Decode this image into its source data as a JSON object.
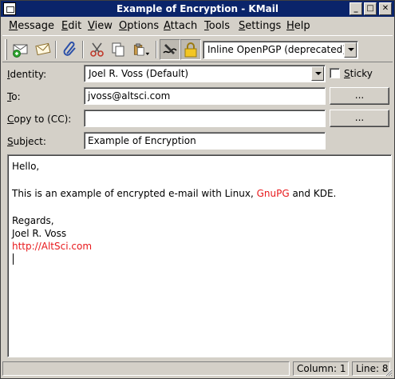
{
  "window": {
    "title": "Example of Encryption - KMail"
  },
  "menubar": {
    "items": [
      "Message",
      "Edit",
      "View",
      "Options",
      "Attach",
      "Tools",
      "Settings",
      "Help"
    ]
  },
  "toolbar": {
    "icons": [
      "send-mail-icon",
      "queue-mail-icon",
      "attach-icon",
      "cut-icon",
      "copy-icon",
      "paste-icon",
      "sign-icon",
      "encrypt-lock-icon"
    ],
    "crypto_format": "Inline OpenPGP (deprecated)"
  },
  "form": {
    "identity_label": "Identity:",
    "identity_value": "Joel R. Voss (Default)",
    "sticky_label": "Sticky",
    "to_label": "To:",
    "to_value": "jvoss@altsci.com",
    "to_button": "...",
    "cc_label": "Copy to (CC):",
    "cc_value": "",
    "cc_button": "...",
    "subject_label": "Subject:",
    "subject_value": "Example of Encryption"
  },
  "body": {
    "greeting": "Hello,",
    "line_pre": "This is an example of encrypted e-mail with Linux, ",
    "line_link": "GnuPG",
    "line_post": " and KDE.",
    "regards": "Regards,",
    "signature_name": "Joel R. Voss",
    "url_prefix": "http://",
    "url_host": "AltSci.com"
  },
  "status": {
    "column": "Column: 1",
    "line": "Line: 8"
  },
  "colors": {
    "title_bg": "#0a246a",
    "link_red": "#e8191c",
    "chrome": "#d4d0c8"
  }
}
